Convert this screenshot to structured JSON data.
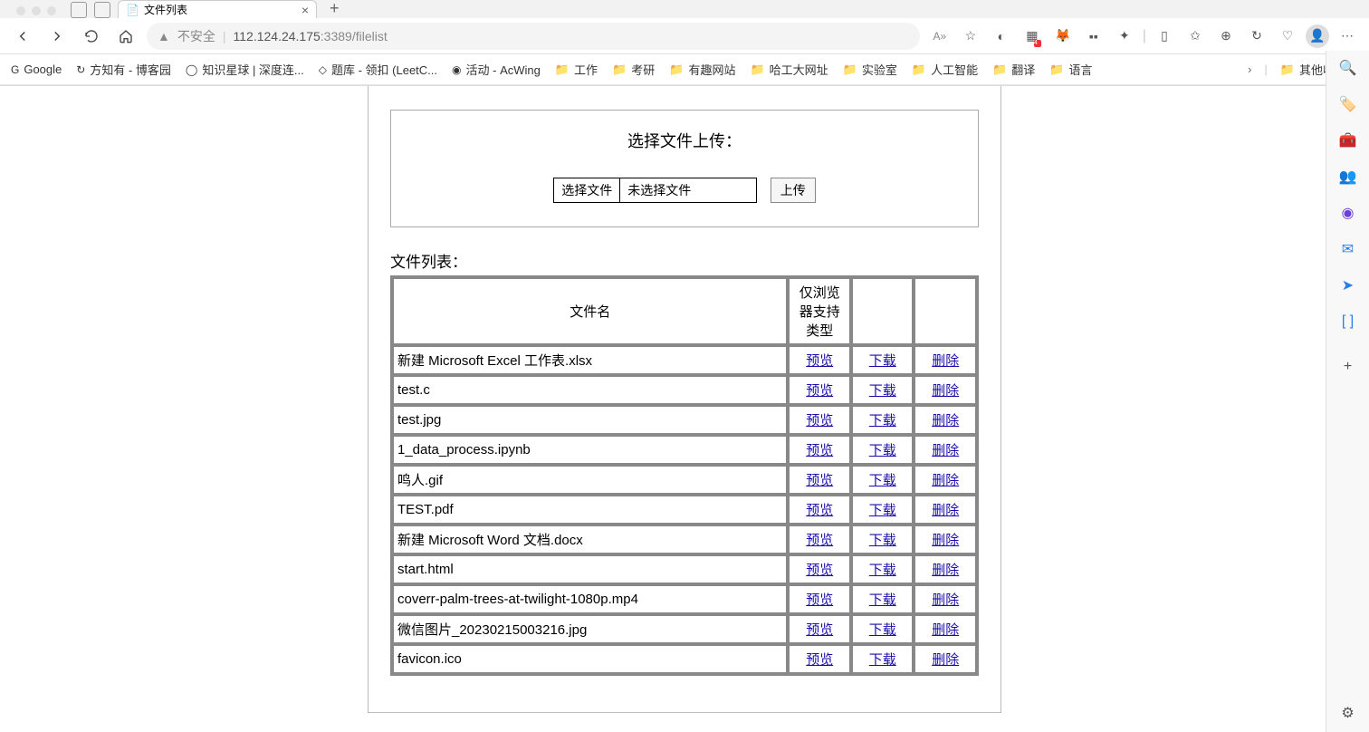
{
  "browser": {
    "tab_title": "文件列表",
    "insecure_label": "不安全",
    "url_host": "112.124.24.175",
    "url_port": ":3389",
    "url_path": "/filelist",
    "read_aloud": "A»"
  },
  "bookmarks": [
    {
      "label": "Google",
      "type": "site"
    },
    {
      "label": "方知有 - 博客园",
      "type": "site"
    },
    {
      "label": "知识星球 | 深度连...",
      "type": "site"
    },
    {
      "label": "题库 - 领扣 (LeetC...",
      "type": "site"
    },
    {
      "label": "活动 - AcWing",
      "type": "site"
    },
    {
      "label": "工作",
      "type": "folder"
    },
    {
      "label": "考研",
      "type": "folder"
    },
    {
      "label": "有趣网站",
      "type": "folder"
    },
    {
      "label": "哈工大网址",
      "type": "folder"
    },
    {
      "label": "实验室",
      "type": "folder"
    },
    {
      "label": "人工智能",
      "type": "folder"
    },
    {
      "label": "翻译",
      "type": "folder"
    },
    {
      "label": "语言",
      "type": "folder"
    }
  ],
  "bookmarks_other": "其他收藏夹",
  "upload": {
    "title": "选择文件上传：",
    "choose_label": "选择文件",
    "no_file": "未选择文件",
    "submit": "上传"
  },
  "list_title": "文件列表：",
  "table": {
    "col_name": "文件名",
    "col_type": "仅浏览器支持类型",
    "preview": "预览",
    "download": "下载",
    "delete": "删除"
  },
  "files": [
    {
      "name": "新建 Microsoft Excel 工作表.xlsx"
    },
    {
      "name": "test.c"
    },
    {
      "name": "test.jpg"
    },
    {
      "name": "1_data_process.ipynb"
    },
    {
      "name": "鸣人.gif"
    },
    {
      "name": "TEST.pdf"
    },
    {
      "name": "新建 Microsoft Word 文档.docx"
    },
    {
      "name": "start.html"
    },
    {
      "name": "coverr-palm-trees-at-twilight-1080p.mp4"
    },
    {
      "name": "微信图片_20230215003216.jpg"
    },
    {
      "name": "favicon.ico"
    }
  ]
}
